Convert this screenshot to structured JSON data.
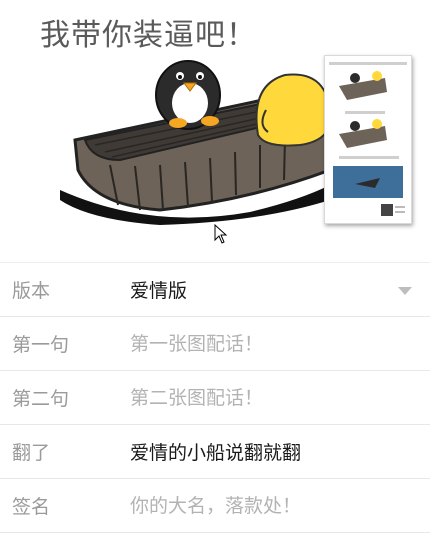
{
  "meme": {
    "caption": "我带你装逼吧！"
  },
  "form": {
    "rows": [
      {
        "label": "版本",
        "value": "爱情版",
        "placeholder": ""
      },
      {
        "label": "第一句",
        "value": "",
        "placeholder": "第一张图配话！"
      },
      {
        "label": "第二句",
        "value": "",
        "placeholder": "第二张图配话！"
      },
      {
        "label": "翻了",
        "value": "爱情的小船说翻就翻",
        "placeholder": ""
      },
      {
        "label": "签名",
        "value": "",
        "placeholder": "你的大名，落款处！"
      }
    ]
  },
  "icons": {
    "dropdown": "chevron-down-icon",
    "cursor": "mouse-cursor-icon"
  }
}
